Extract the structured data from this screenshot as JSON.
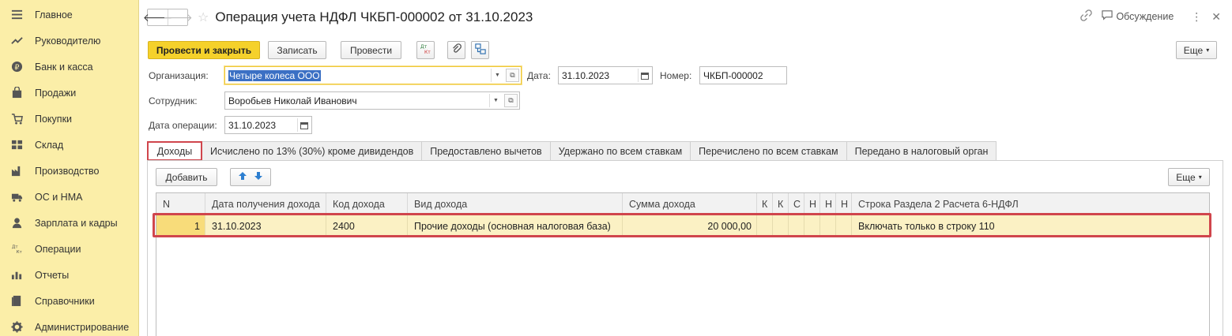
{
  "sidebar": {
    "items": [
      {
        "label": "Главное",
        "icon": "menu-icon"
      },
      {
        "label": "Руководителю",
        "icon": "trend-icon"
      },
      {
        "label": "Банк и касса",
        "icon": "ruble-icon"
      },
      {
        "label": "Продажи",
        "icon": "bag-icon"
      },
      {
        "label": "Покупки",
        "icon": "cart-icon"
      },
      {
        "label": "Склад",
        "icon": "warehouse-icon"
      },
      {
        "label": "Производство",
        "icon": "factory-icon"
      },
      {
        "label": "ОС и НМА",
        "icon": "truck-icon"
      },
      {
        "label": "Зарплата и кадры",
        "icon": "person-icon"
      },
      {
        "label": "Операции",
        "icon": "dt-kt-icon"
      },
      {
        "label": "Отчеты",
        "icon": "chart-icon"
      },
      {
        "label": "Справочники",
        "icon": "book-icon"
      },
      {
        "label": "Администрирование",
        "icon": "gear-icon"
      }
    ]
  },
  "header": {
    "title": "Операция учета НДФЛ ЧКБП-000002 от 31.10.2023",
    "back": "🡐",
    "forward": "🡒",
    "star": "☆",
    "discussion": "Обсуждение",
    "more": "⋮",
    "close": "✕"
  },
  "toolbar": {
    "post_close": "Провести и закрыть",
    "save": "Записать",
    "post": "Провести",
    "more": "Еще"
  },
  "form": {
    "org_label": "Организация:",
    "org_value": "Четыре колеса ООО",
    "date_label": "Дата:",
    "date_value": "31.10.2023",
    "number_label": "Номер:",
    "number_value": "ЧКБП-000002",
    "employee_label": "Сотрудник:",
    "employee_value": "Воробьев Николай Иванович",
    "opdate_label": "Дата операции:",
    "opdate_value": "31.10.2023"
  },
  "tabs": [
    {
      "label": "Доходы",
      "active": true
    },
    {
      "label": "Исчислено по 13% (30%) кроме дивидендов"
    },
    {
      "label": "Предоставлено вычетов"
    },
    {
      "label": "Удержано по всем ставкам"
    },
    {
      "label": "Перечислено по всем ставкам"
    },
    {
      "label": "Передано в налоговый орган"
    }
  ],
  "table_toolbar": {
    "add": "Добавить",
    "more": "Еще"
  },
  "table": {
    "columns": [
      "N",
      "Дата получения дохода",
      "Код дохода",
      "Вид дохода",
      "Сумма дохода",
      "К",
      "К",
      "С",
      "Н",
      "Н",
      "Н",
      "Строка Раздела 2 Расчета 6-НДФЛ"
    ],
    "rows": [
      [
        "1",
        "31.10.2023",
        "2400",
        "Прочие доходы (основная налоговая база)",
        "20 000,00",
        "",
        "",
        "",
        "",
        "",
        "",
        "Включать только в строку 110"
      ]
    ]
  },
  "colors": {
    "sidebar_bg": "#fbeea8",
    "primary_button": "#f5d12b",
    "highlight": "#d0454c",
    "selected_row": "#fbf1c4"
  }
}
